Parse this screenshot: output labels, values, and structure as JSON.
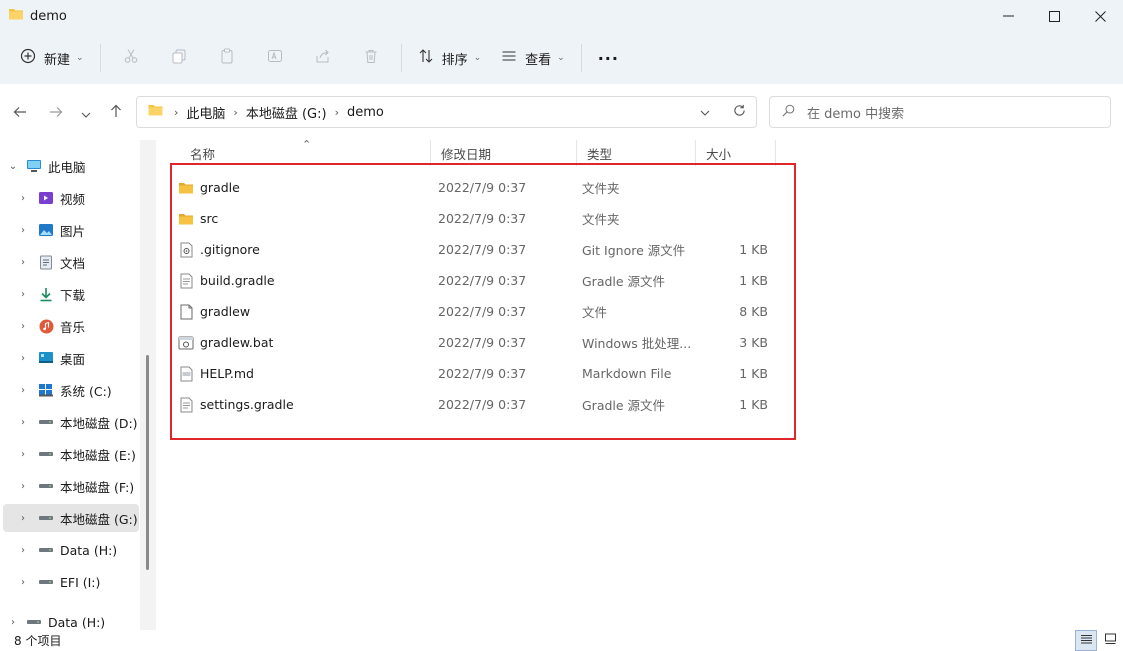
{
  "window": {
    "title": "demo"
  },
  "toolbar": {
    "new_label": "新建",
    "sort_label": "排序",
    "view_label": "查看",
    "more_label": "···"
  },
  "address": {
    "crumbs": [
      "此电脑",
      "本地磁盘 (G:)",
      "demo"
    ]
  },
  "search": {
    "placeholder": "在 demo 中搜索"
  },
  "sidebar": {
    "items": [
      {
        "label": "此电脑",
        "icon": "pc-icon"
      },
      {
        "label": "视频",
        "icon": "video-icon"
      },
      {
        "label": "图片",
        "icon": "picture-icon"
      },
      {
        "label": "文档",
        "icon": "document-icon"
      },
      {
        "label": "下载",
        "icon": "download-icon"
      },
      {
        "label": "音乐",
        "icon": "music-icon"
      },
      {
        "label": "桌面",
        "icon": "desktop-icon"
      },
      {
        "label": "系统 (C:)",
        "icon": "system-drive-icon"
      },
      {
        "label": "本地磁盘 (D:)",
        "icon": "drive-icon"
      },
      {
        "label": "本地磁盘 (E:)",
        "icon": "drive-icon"
      },
      {
        "label": "本地磁盘 (F:)",
        "icon": "drive-icon"
      },
      {
        "label": "本地磁盘 (G:)",
        "icon": "drive-icon",
        "selected": true
      },
      {
        "label": "Data (H:)",
        "icon": "drive-icon"
      },
      {
        "label": "EFI (I:)",
        "icon": "drive-icon"
      },
      {
        "label": "Data (H:)",
        "icon": "drive-icon"
      }
    ]
  },
  "columns": {
    "name": "名称",
    "date": "修改日期",
    "type": "类型",
    "size": "大小"
  },
  "files": [
    {
      "name": "gradle",
      "date": "2022/7/9 0:37",
      "type": "文件夹",
      "size": "",
      "icon": "folder-icon"
    },
    {
      "name": "src",
      "date": "2022/7/9 0:37",
      "type": "文件夹",
      "size": "",
      "icon": "folder-icon"
    },
    {
      "name": ".gitignore",
      "date": "2022/7/9 0:37",
      "type": "Git Ignore 源文件",
      "size": "1 KB",
      "icon": "config-file-icon"
    },
    {
      "name": "build.gradle",
      "date": "2022/7/9 0:37",
      "type": "Gradle 源文件",
      "size": "1 KB",
      "icon": "text-file-icon"
    },
    {
      "name": "gradlew",
      "date": "2022/7/9 0:37",
      "type": "文件",
      "size": "8 KB",
      "icon": "blank-file-icon"
    },
    {
      "name": "gradlew.bat",
      "date": "2022/7/9 0:37",
      "type": "Windows 批处理...",
      "size": "3 KB",
      "icon": "batch-file-icon"
    },
    {
      "name": "HELP.md",
      "date": "2022/7/9 0:37",
      "type": "Markdown File",
      "size": "1 KB",
      "icon": "markdown-file-icon"
    },
    {
      "name": "settings.gradle",
      "date": "2022/7/9 0:37",
      "type": "Gradle 源文件",
      "size": "1 KB",
      "icon": "text-file-icon"
    }
  ],
  "status": {
    "count": "8 个项目"
  },
  "colors": {
    "highlight": "#e0252b",
    "folder": "#f5c242",
    "chrome": "#eef3f8"
  }
}
